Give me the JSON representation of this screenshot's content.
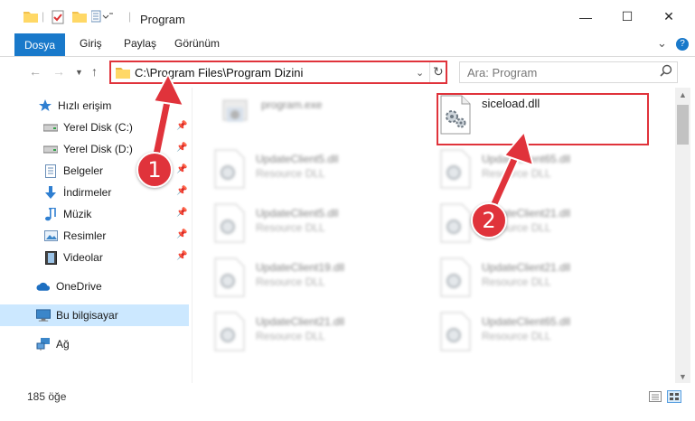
{
  "window": {
    "title": "Program",
    "minimize_glyph": "—",
    "maximize_glyph": "☐",
    "close_glyph": "✕"
  },
  "ribbon": {
    "file_tab": "Dosya",
    "tabs": [
      "Giriş",
      "Paylaş",
      "Görünüm"
    ],
    "help_glyph": "?",
    "expand_glyph": "⌄"
  },
  "address": {
    "path": "C:\\Program Files\\Program Dizini",
    "search_placeholder": "Ara: Program"
  },
  "sidebar": {
    "items": [
      {
        "label": "Hızlı erişim",
        "icon": "star-icon",
        "pinned": false
      },
      {
        "label": "Yerel Disk (C:)",
        "icon": "drive-icon",
        "pinned": true
      },
      {
        "label": "Yerel Disk (D:)",
        "icon": "drive-icon",
        "pinned": true
      },
      {
        "label": "Belgeler",
        "icon": "documents-icon",
        "pinned": true
      },
      {
        "label": "İndirmeler",
        "icon": "download-icon",
        "pinned": true
      },
      {
        "label": "Müzik",
        "icon": "music-icon",
        "pinned": true
      },
      {
        "label": "Resimler",
        "icon": "pictures-icon",
        "pinned": true
      },
      {
        "label": "Videolar",
        "icon": "videos-icon",
        "pinned": true
      },
      {
        "label": "OneDrive",
        "icon": "cloud-icon",
        "pinned": false
      },
      {
        "label": "Bu bilgisayar",
        "icon": "computer-icon",
        "pinned": false
      },
      {
        "label": "Ağ",
        "icon": "network-icon",
        "pinned": false
      }
    ]
  },
  "files": [
    {
      "name": "program.exe",
      "type": "",
      "blurred": true
    },
    {
      "name": "siceload.dll",
      "type": "",
      "blurred": false
    },
    {
      "name": "UpdateClient5.dll",
      "type": "Resource DLL",
      "blurred": true
    },
    {
      "name": "UpdateClient65.dll",
      "type": "Resource DLL",
      "blurred": true
    },
    {
      "name": "UpdateClient5.dll",
      "type": "Resource DLL",
      "blurred": true
    },
    {
      "name": "UpdateClient21.dll",
      "type": "Resource DLL",
      "blurred": true
    },
    {
      "name": "UpdateClient19.dll",
      "type": "Resource DLL",
      "blurred": true
    },
    {
      "name": "UpdateClient21.dll",
      "type": "Resource DLL",
      "blurred": true
    },
    {
      "name": "UpdateClient21.dll",
      "type": "Resource DLL",
      "blurred": true
    },
    {
      "name": "UpdateClient65.dll",
      "type": "Resource DLL",
      "blurred": true
    }
  ],
  "status": {
    "item_count": "185 öğe"
  },
  "callouts": {
    "step1": "1",
    "step2": "2"
  },
  "colors": {
    "accent": "#1979ca",
    "highlight": "#e0333b",
    "selected": "#cce8ff"
  }
}
